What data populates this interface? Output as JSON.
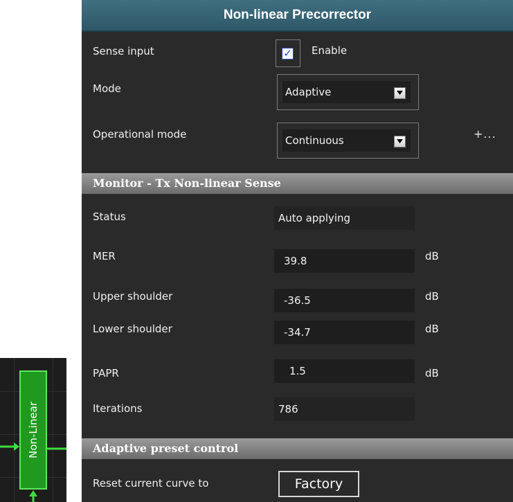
{
  "panel": {
    "title": "Non-linear Precorrector",
    "sense_input": {
      "label": "Sense input",
      "checkbox_checked": true,
      "enable_label": "Enable"
    },
    "mode": {
      "label": "Mode",
      "value": "Adaptive"
    },
    "operational_mode": {
      "label": "Operational mode",
      "value": "Continuous"
    },
    "more_label": "+...",
    "monitor": {
      "title": "Monitor - Tx Non-linear Sense",
      "status": {
        "label": "Status",
        "value": "Auto applying"
      },
      "mer": {
        "label": "MER",
        "value": "39.8",
        "unit": "dB"
      },
      "upper_shoulder": {
        "label": "Upper shoulder",
        "value": "-36.5",
        "unit": "dB"
      },
      "lower_shoulder": {
        "label": "Lower shoulder",
        "value": "-34.7",
        "unit": "dB"
      },
      "papr": {
        "label": "PAPR",
        "value": "1.5",
        "unit": "dB"
      },
      "iterations": {
        "label": "Iterations",
        "value": "786"
      }
    },
    "preset": {
      "title": "Adaptive preset control",
      "reset_label": "Reset current curve to",
      "factory_button": "Factory"
    }
  },
  "block": {
    "label": "Non-Linear"
  },
  "colors": {
    "panel_bg": "#2a2a2a",
    "title_bar": "#3a6878",
    "section_bar": "#8a8a8a",
    "block_green": "#1f9a1f",
    "block_border": "#5de85d",
    "checkbox_check": "#2b4fb0"
  },
  "icons": {
    "checkbox": "check-icon",
    "dropdown": "chevron-down-icon",
    "arrows": "arrow-icon"
  }
}
